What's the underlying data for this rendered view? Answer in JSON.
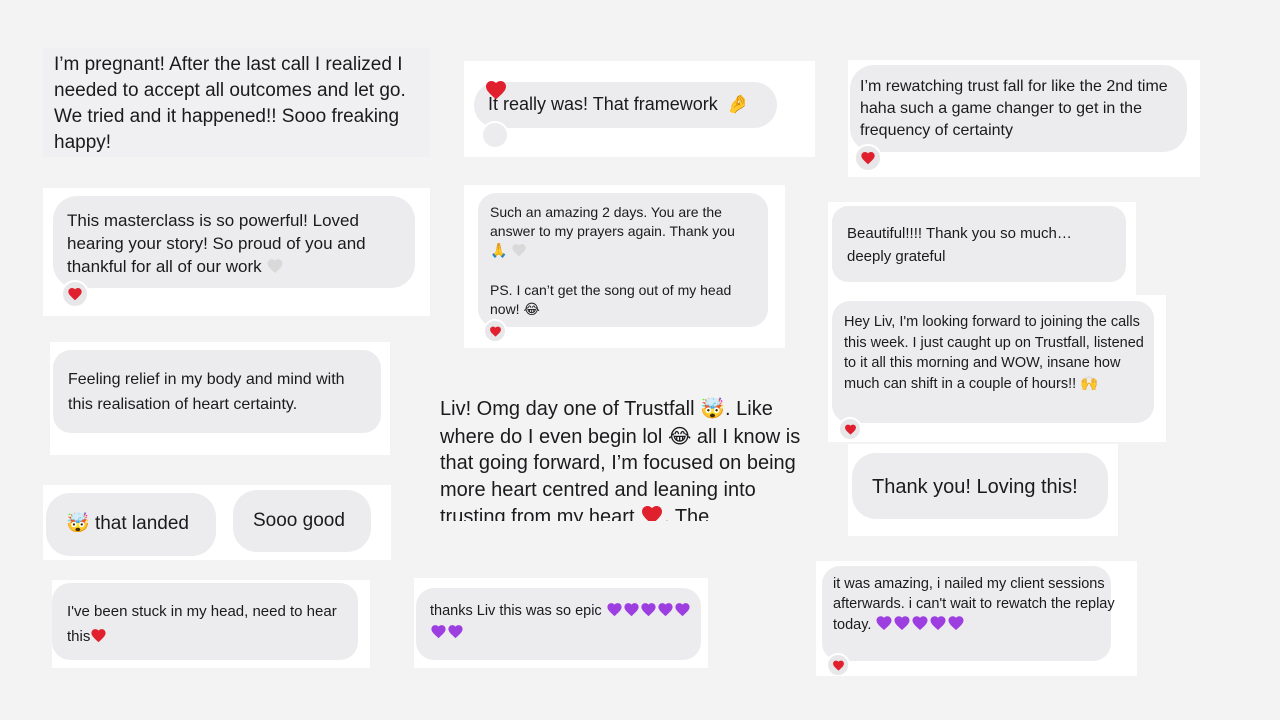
{
  "messages": {
    "m1": "I’m pregnant! After the last call I realized I needed to accept all outcomes and let go. We tried and it happened!! Sooo freaking happy!",
    "m2": "It really was! That framework",
    "m3": "I’m rewatching trust fall for like the 2nd time haha such a game changer to get in the frequency of certainty",
    "m4": "This masterclass is so powerful! Loved hearing your story! So proud of you and thankful for all of our work",
    "m5a": "Such an amazing 2 days. You are the answer to my prayers again. Thank you",
    "m5b": "PS. I can’t get the song out of my head now!",
    "m6": "Beautiful!!!!  Thank you so much… deeply grateful",
    "m7": "Hey Liv, I'm looking forward to joining the calls this week.  I just caught up on Trustfall, listened to it all this morning and WOW, insane how much can shift in a couple of hours!!",
    "m8": "Feeling relief in my body and mind with this realisation of heart certainty.",
    "m9a": "Liv! Omg day one of Trustfall",
    "m9b": ". Like where do I even begin lol",
    "m9c": " all I know is that going forward, I’m focused on being more heart centred and leaning into trusting from my heart",
    "m9d": ". The",
    "m10": "Thank you! Loving this!",
    "m11": "that landed",
    "m12": "Sooo good",
    "m13": "I've been stuck in my head, need to hear this",
    "m14": "thanks Liv this was so epic",
    "m15": "it was amazing, i nailed my client sessions afterwards. i can't wait to rewatch the replay today."
  },
  "icons": {
    "reaction": "red-heart-icon",
    "heart_colors": {
      "red": "#e0212d",
      "purple": "#9d3fe0",
      "white": "#d9d9d9"
    }
  }
}
